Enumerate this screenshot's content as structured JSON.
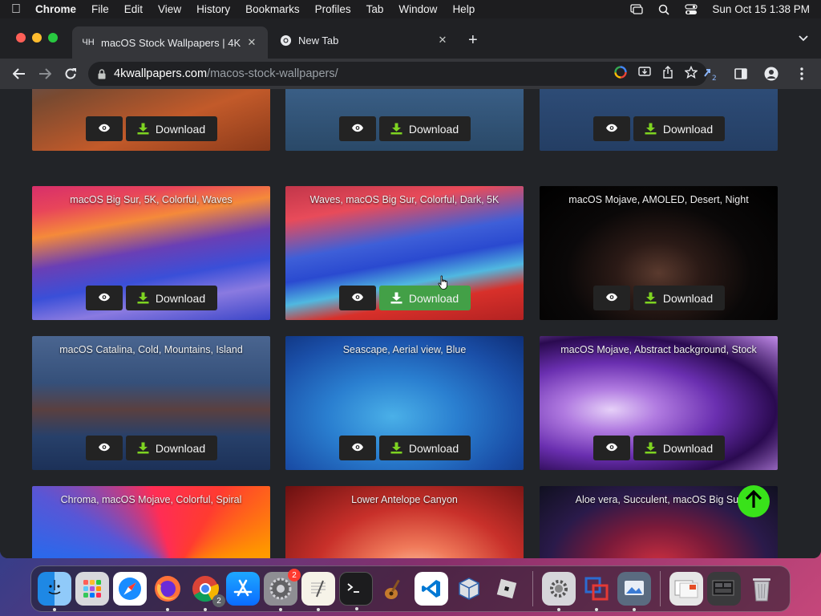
{
  "menubar": {
    "app": "Chrome",
    "items": [
      "File",
      "Edit",
      "View",
      "History",
      "Bookmarks",
      "Profiles",
      "Tab",
      "Window",
      "Help"
    ],
    "clock": "Sun Oct 15  1:38 PM"
  },
  "tabs": [
    {
      "favicon": "ЧН",
      "title": "macOS Stock Wallpapers | 4K",
      "active": true
    },
    {
      "favicon": "chrome-icon",
      "title": "New Tab",
      "active": false
    }
  ],
  "address": {
    "domain": "4kwallpapers.com",
    "path": "/macos-stock-wallpapers/"
  },
  "cards": [
    {
      "caption": "",
      "download_label": "Download"
    },
    {
      "caption": "",
      "download_label": "Download"
    },
    {
      "caption": "",
      "download_label": "Download"
    },
    {
      "caption": "macOS Big Sur, 5K, Colorful, Waves",
      "download_label": "Download"
    },
    {
      "caption": "Waves, macOS Big Sur, Colorful, Dark, 5K",
      "download_label": "Download"
    },
    {
      "caption": "macOS Mojave, AMOLED, Desert, Night",
      "download_label": "Download"
    },
    {
      "caption": "macOS Catalina, Cold, Mountains, Island",
      "download_label": "Download"
    },
    {
      "caption": "Seascape, Aerial view, Blue",
      "download_label": "Download"
    },
    {
      "caption": "macOS Mojave, Abstract background, Stock",
      "download_label": "Download"
    },
    {
      "caption": "Chroma, macOS Mojave, Colorful, Spiral",
      "download_label": "Download"
    },
    {
      "caption": "Lower Antelope Canyon",
      "download_label": "Download"
    },
    {
      "caption": "Aloe vera, Succulent, macOS Big Sur",
      "download_label": "Download"
    }
  ],
  "dock": {
    "settings_badge": "2",
    "chrome_badge": "2"
  },
  "colors": {
    "accent_green": "#39e21a",
    "download_hover": "#43a047",
    "download_icon": "#7ed321"
  }
}
